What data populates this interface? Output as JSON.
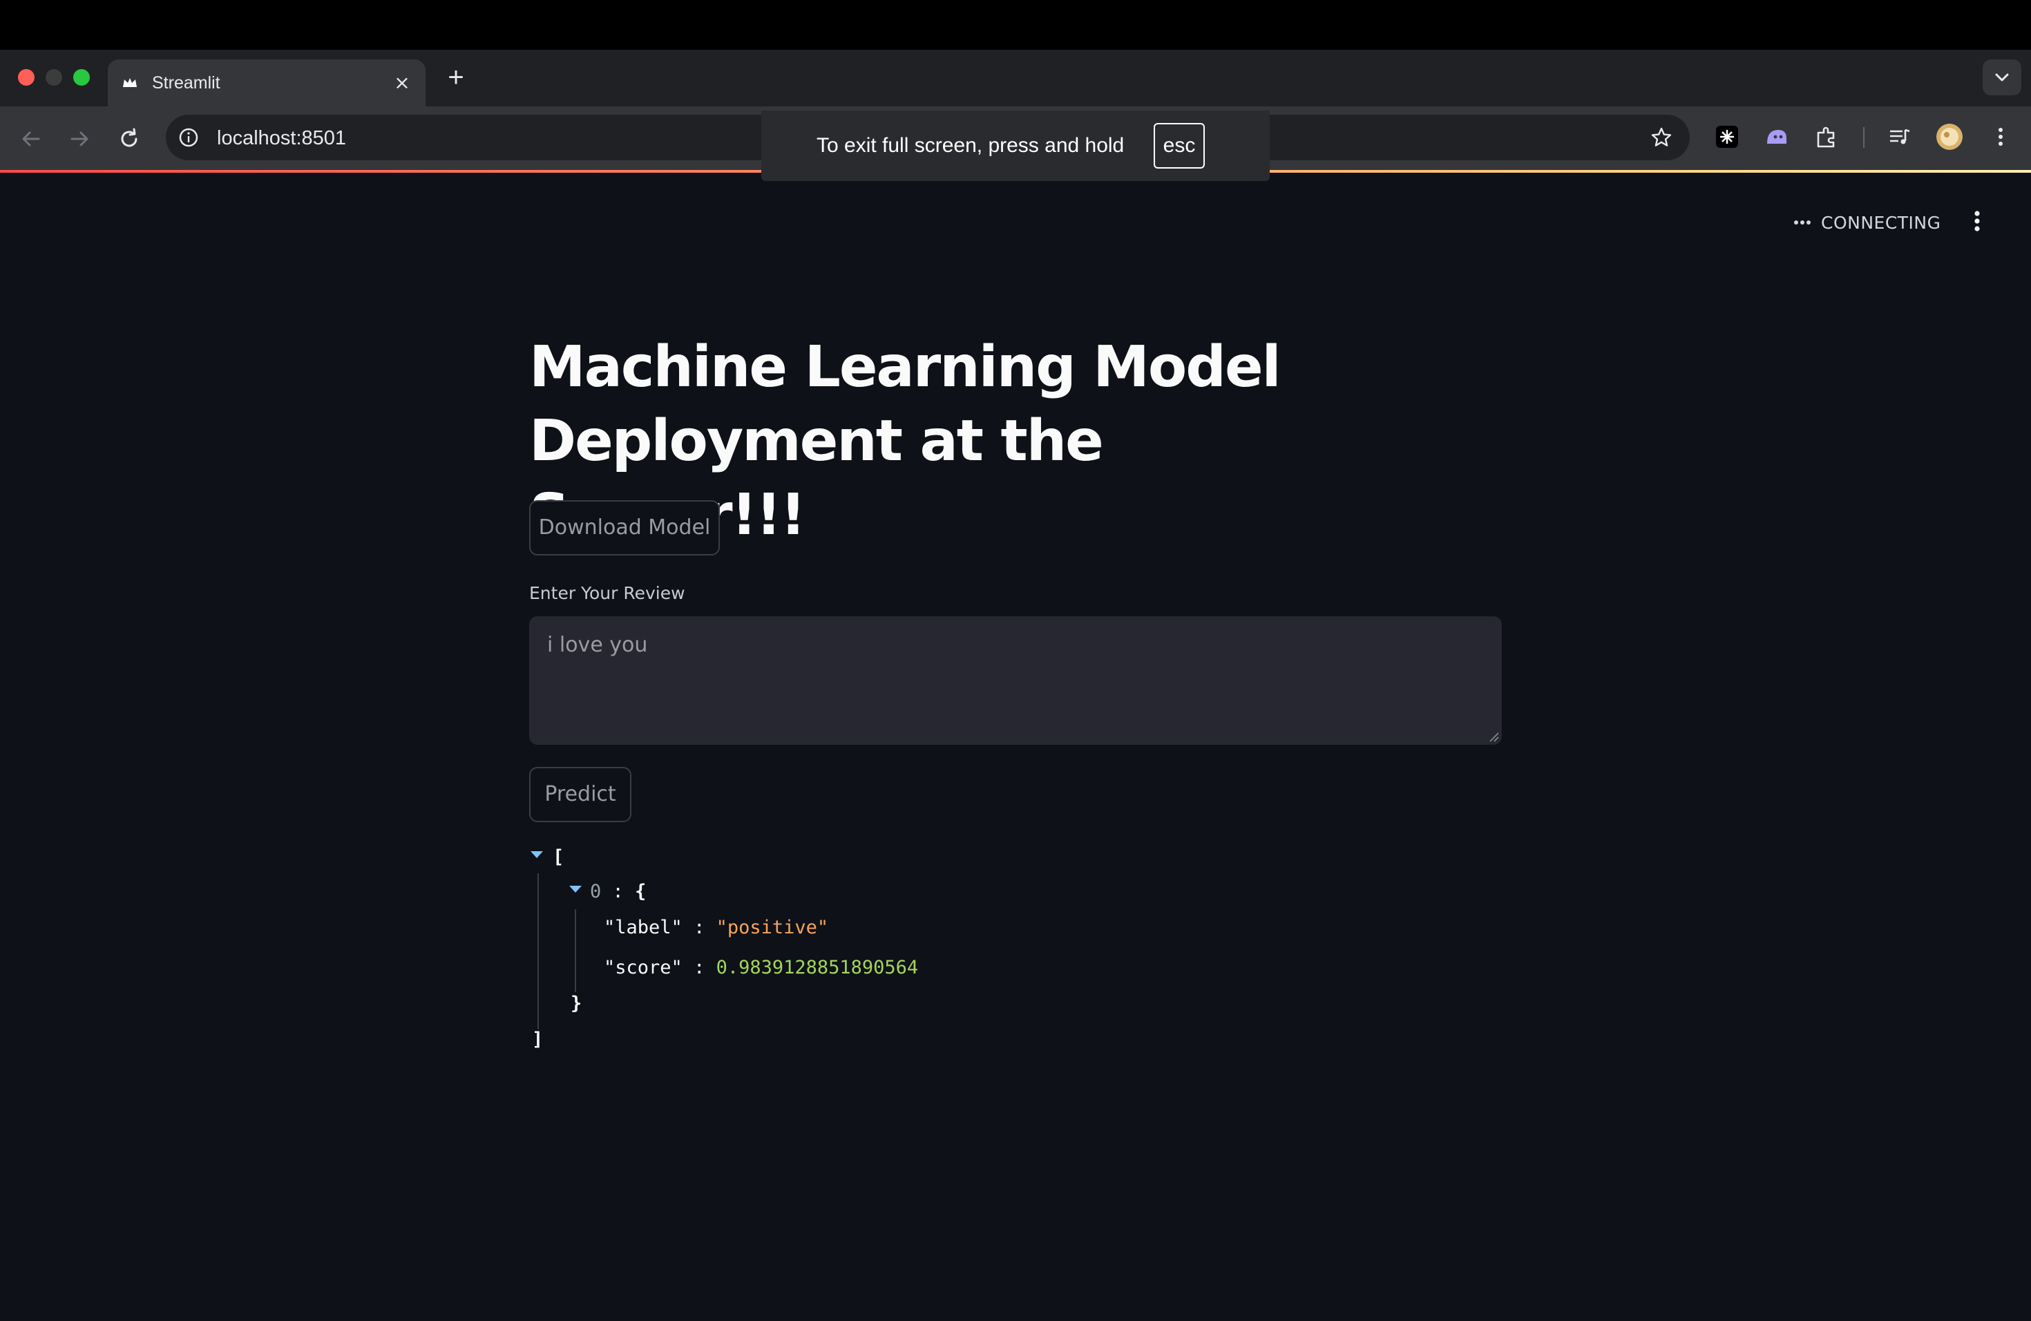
{
  "browser": {
    "tab_title": "Streamlit",
    "tab_close": "×",
    "new_tab": "+",
    "url": "localhost:8501",
    "fullscreen_notice": "To exit full screen, press and hold",
    "fullscreen_key": "esc"
  },
  "app": {
    "status": "CONNECTING",
    "title": "Machine Learning Model Deployment at the Server!!!",
    "download_button": "Download Model",
    "review_label": "Enter Your Review",
    "review_value": "i love you",
    "predict_button": "Predict"
  },
  "result": {
    "open_bracket": "[",
    "close_bracket": "]",
    "item_index": "0",
    "colon": ":",
    "open_brace": "{",
    "close_brace": "}",
    "label_key": "\"label\"",
    "label_value": "\"positive\"",
    "score_key": "\"score\"",
    "score_value": "0.9839128851890564"
  },
  "colors": {
    "app_background": "#0e1117",
    "string_value": "#f7a45c",
    "number_value": "#a3d55c",
    "accent": "#ff4b4b"
  },
  "icons": [
    "streamlit-crown-icon",
    "close-icon",
    "plus-icon",
    "chevron-down-icon",
    "back-arrow-icon",
    "forward-arrow-icon",
    "reload-icon",
    "info-icon",
    "star-icon",
    "extension-icon",
    "puzzle-icon",
    "media-icon",
    "avatar",
    "kebab-menu-icon",
    "ellipsis-icon"
  ]
}
